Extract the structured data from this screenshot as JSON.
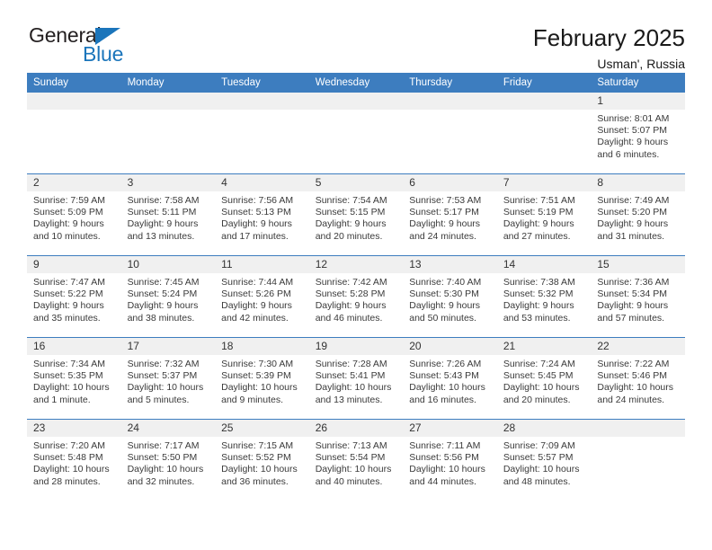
{
  "brand": {
    "name_part1": "General",
    "name_part2": "Blue",
    "accent_color": "#1b75bb"
  },
  "header": {
    "title": "February 2025",
    "subtitle": "Usman', Russia"
  },
  "calendar": {
    "header_color": "#3d7dbf",
    "weekdays": [
      "Sunday",
      "Monday",
      "Tuesday",
      "Wednesday",
      "Thursday",
      "Friday",
      "Saturday"
    ],
    "weeks": [
      [
        {
          "day": "",
          "empty": true
        },
        {
          "day": "",
          "empty": true
        },
        {
          "day": "",
          "empty": true
        },
        {
          "day": "",
          "empty": true
        },
        {
          "day": "",
          "empty": true
        },
        {
          "day": "",
          "empty": true
        },
        {
          "day": "1",
          "sunrise": "Sunrise: 8:01 AM",
          "sunset": "Sunset: 5:07 PM",
          "daylight1": "Daylight: 9 hours",
          "daylight2": "and 6 minutes."
        }
      ],
      [
        {
          "day": "2",
          "sunrise": "Sunrise: 7:59 AM",
          "sunset": "Sunset: 5:09 PM",
          "daylight1": "Daylight: 9 hours",
          "daylight2": "and 10 minutes."
        },
        {
          "day": "3",
          "sunrise": "Sunrise: 7:58 AM",
          "sunset": "Sunset: 5:11 PM",
          "daylight1": "Daylight: 9 hours",
          "daylight2": "and 13 minutes."
        },
        {
          "day": "4",
          "sunrise": "Sunrise: 7:56 AM",
          "sunset": "Sunset: 5:13 PM",
          "daylight1": "Daylight: 9 hours",
          "daylight2": "and 17 minutes."
        },
        {
          "day": "5",
          "sunrise": "Sunrise: 7:54 AM",
          "sunset": "Sunset: 5:15 PM",
          "daylight1": "Daylight: 9 hours",
          "daylight2": "and 20 minutes."
        },
        {
          "day": "6",
          "sunrise": "Sunrise: 7:53 AM",
          "sunset": "Sunset: 5:17 PM",
          "daylight1": "Daylight: 9 hours",
          "daylight2": "and 24 minutes."
        },
        {
          "day": "7",
          "sunrise": "Sunrise: 7:51 AM",
          "sunset": "Sunset: 5:19 PM",
          "daylight1": "Daylight: 9 hours",
          "daylight2": "and 27 minutes."
        },
        {
          "day": "8",
          "sunrise": "Sunrise: 7:49 AM",
          "sunset": "Sunset: 5:20 PM",
          "daylight1": "Daylight: 9 hours",
          "daylight2": "and 31 minutes."
        }
      ],
      [
        {
          "day": "9",
          "sunrise": "Sunrise: 7:47 AM",
          "sunset": "Sunset: 5:22 PM",
          "daylight1": "Daylight: 9 hours",
          "daylight2": "and 35 minutes."
        },
        {
          "day": "10",
          "sunrise": "Sunrise: 7:45 AM",
          "sunset": "Sunset: 5:24 PM",
          "daylight1": "Daylight: 9 hours",
          "daylight2": "and 38 minutes."
        },
        {
          "day": "11",
          "sunrise": "Sunrise: 7:44 AM",
          "sunset": "Sunset: 5:26 PM",
          "daylight1": "Daylight: 9 hours",
          "daylight2": "and 42 minutes."
        },
        {
          "day": "12",
          "sunrise": "Sunrise: 7:42 AM",
          "sunset": "Sunset: 5:28 PM",
          "daylight1": "Daylight: 9 hours",
          "daylight2": "and 46 minutes."
        },
        {
          "day": "13",
          "sunrise": "Sunrise: 7:40 AM",
          "sunset": "Sunset: 5:30 PM",
          "daylight1": "Daylight: 9 hours",
          "daylight2": "and 50 minutes."
        },
        {
          "day": "14",
          "sunrise": "Sunrise: 7:38 AM",
          "sunset": "Sunset: 5:32 PM",
          "daylight1": "Daylight: 9 hours",
          "daylight2": "and 53 minutes."
        },
        {
          "day": "15",
          "sunrise": "Sunrise: 7:36 AM",
          "sunset": "Sunset: 5:34 PM",
          "daylight1": "Daylight: 9 hours",
          "daylight2": "and 57 minutes."
        }
      ],
      [
        {
          "day": "16",
          "sunrise": "Sunrise: 7:34 AM",
          "sunset": "Sunset: 5:35 PM",
          "daylight1": "Daylight: 10 hours",
          "daylight2": "and 1 minute."
        },
        {
          "day": "17",
          "sunrise": "Sunrise: 7:32 AM",
          "sunset": "Sunset: 5:37 PM",
          "daylight1": "Daylight: 10 hours",
          "daylight2": "and 5 minutes."
        },
        {
          "day": "18",
          "sunrise": "Sunrise: 7:30 AM",
          "sunset": "Sunset: 5:39 PM",
          "daylight1": "Daylight: 10 hours",
          "daylight2": "and 9 minutes."
        },
        {
          "day": "19",
          "sunrise": "Sunrise: 7:28 AM",
          "sunset": "Sunset: 5:41 PM",
          "daylight1": "Daylight: 10 hours",
          "daylight2": "and 13 minutes."
        },
        {
          "day": "20",
          "sunrise": "Sunrise: 7:26 AM",
          "sunset": "Sunset: 5:43 PM",
          "daylight1": "Daylight: 10 hours",
          "daylight2": "and 16 minutes."
        },
        {
          "day": "21",
          "sunrise": "Sunrise: 7:24 AM",
          "sunset": "Sunset: 5:45 PM",
          "daylight1": "Daylight: 10 hours",
          "daylight2": "and 20 minutes."
        },
        {
          "day": "22",
          "sunrise": "Sunrise: 7:22 AM",
          "sunset": "Sunset: 5:46 PM",
          "daylight1": "Daylight: 10 hours",
          "daylight2": "and 24 minutes."
        }
      ],
      [
        {
          "day": "23",
          "sunrise": "Sunrise: 7:20 AM",
          "sunset": "Sunset: 5:48 PM",
          "daylight1": "Daylight: 10 hours",
          "daylight2": "and 28 minutes."
        },
        {
          "day": "24",
          "sunrise": "Sunrise: 7:17 AM",
          "sunset": "Sunset: 5:50 PM",
          "daylight1": "Daylight: 10 hours",
          "daylight2": "and 32 minutes."
        },
        {
          "day": "25",
          "sunrise": "Sunrise: 7:15 AM",
          "sunset": "Sunset: 5:52 PM",
          "daylight1": "Daylight: 10 hours",
          "daylight2": "and 36 minutes."
        },
        {
          "day": "26",
          "sunrise": "Sunrise: 7:13 AM",
          "sunset": "Sunset: 5:54 PM",
          "daylight1": "Daylight: 10 hours",
          "daylight2": "and 40 minutes."
        },
        {
          "day": "27",
          "sunrise": "Sunrise: 7:11 AM",
          "sunset": "Sunset: 5:56 PM",
          "daylight1": "Daylight: 10 hours",
          "daylight2": "and 44 minutes."
        },
        {
          "day": "28",
          "sunrise": "Sunrise: 7:09 AM",
          "sunset": "Sunset: 5:57 PM",
          "daylight1": "Daylight: 10 hours",
          "daylight2": "and 48 minutes."
        },
        {
          "day": "",
          "empty": true
        }
      ]
    ]
  }
}
